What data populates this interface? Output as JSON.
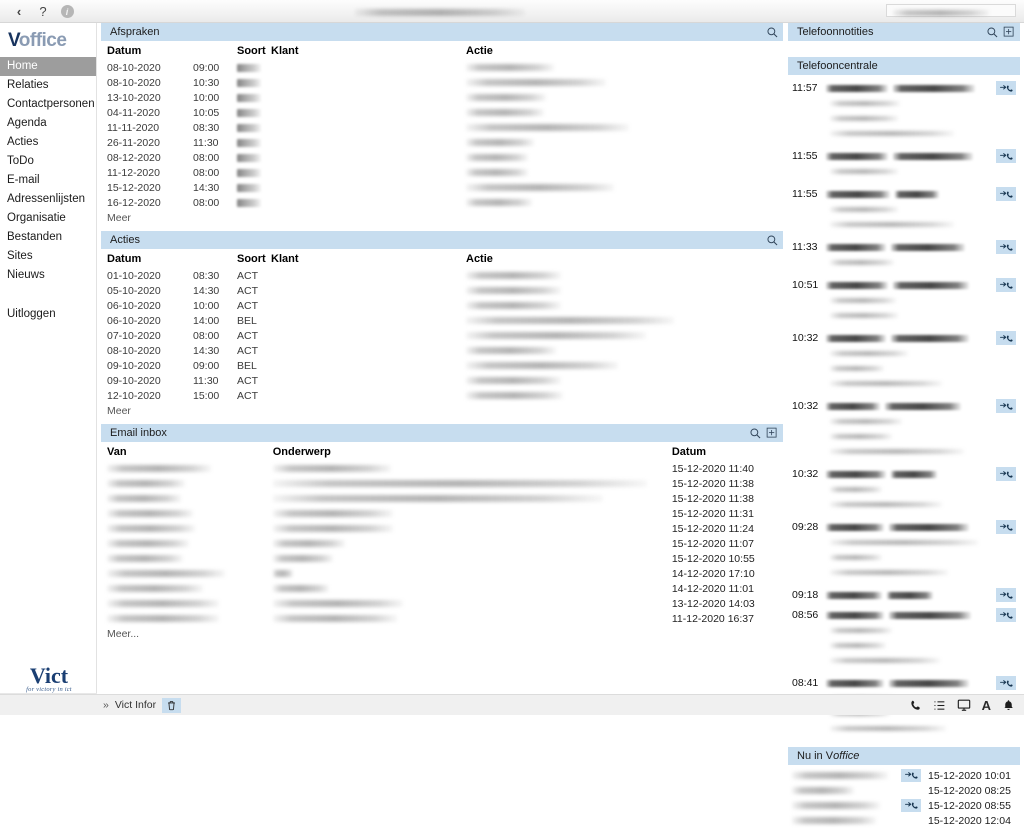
{
  "window": {
    "back_label": "‹",
    "help_label": "?",
    "info_label": "i",
    "title_redacted": true
  },
  "sidebar": {
    "logo_v": "V",
    "logo_office": "office",
    "items": [
      {
        "label": "Home",
        "active": true
      },
      {
        "label": "Relaties",
        "active": false
      },
      {
        "label": "Contactpersonen",
        "active": false
      },
      {
        "label": "Agenda",
        "active": false
      },
      {
        "label": "Acties",
        "active": false
      },
      {
        "label": "ToDo",
        "active": false
      },
      {
        "label": "E-mail",
        "active": false
      },
      {
        "label": "Adressenlijsten",
        "active": false
      },
      {
        "label": "Organisatie",
        "active": false
      },
      {
        "label": "Bestanden",
        "active": false
      },
      {
        "label": "Sites",
        "active": false
      },
      {
        "label": "Nieuws",
        "active": false
      }
    ],
    "logout_label": "Uitloggen",
    "footer_logo": "Vict",
    "footer_tagline": "for victory in ict"
  },
  "afspraken": {
    "title": "Afspraken",
    "columns": {
      "datum": "Datum",
      "soort": "Soort",
      "klant": "Klant",
      "actie": "Actie"
    },
    "rows": [
      {
        "datum": "08-10-2020",
        "tijd": "09:00",
        "soort_w": 24,
        "klant_w": 0,
        "actie_w": 88
      },
      {
        "datum": "08-10-2020",
        "tijd": "10:30",
        "soort_w": 24,
        "klant_w": 0,
        "actie_w": 140
      },
      {
        "datum": "13-10-2020",
        "tijd": "10:00",
        "soort_w": 24,
        "klant_w": 0,
        "actie_w": 80
      },
      {
        "datum": "04-11-2020",
        "tijd": "10:05",
        "soort_w": 24,
        "klant_w": 0,
        "actie_w": 78
      },
      {
        "datum": "11-11-2020",
        "tijd": "08:30",
        "soort_w": 24,
        "klant_w": 0,
        "actie_w": 163
      },
      {
        "datum": "26-11-2020",
        "tijd": "11:30",
        "soort_w": 24,
        "klant_w": 0,
        "actie_w": 68
      },
      {
        "datum": "08-12-2020",
        "tijd": "08:00",
        "soort_w": 24,
        "klant_w": 0,
        "actie_w": 62
      },
      {
        "datum": "11-12-2020",
        "tijd": "08:00",
        "soort_w": 24,
        "klant_w": 0,
        "actie_w": 62
      },
      {
        "datum": "15-12-2020",
        "tijd": "14:30",
        "soort_w": 24,
        "klant_w": 0,
        "actie_w": 148
      },
      {
        "datum": "16-12-2020",
        "tijd": "08:00",
        "soort_w": 24,
        "klant_w": 0,
        "actie_w": 66
      }
    ],
    "more_label": "Meer"
  },
  "acties": {
    "title": "Acties",
    "columns": {
      "datum": "Datum",
      "soort": "Soort",
      "klant": "Klant",
      "actie": "Actie"
    },
    "rows": [
      {
        "datum": "01-10-2020",
        "tijd": "08:30",
        "soort": "ACT",
        "actie_w": 95
      },
      {
        "datum": "05-10-2020",
        "tijd": "14:30",
        "soort": "ACT",
        "actie_w": 95
      },
      {
        "datum": "06-10-2020",
        "tijd": "10:00",
        "soort": "ACT",
        "actie_w": 95
      },
      {
        "datum": "06-10-2020",
        "tijd": "14:00",
        "soort": "BEL",
        "actie_w": 208
      },
      {
        "datum": "07-10-2020",
        "tijd": "08:00",
        "soort": "ACT",
        "actie_w": 180
      },
      {
        "datum": "08-10-2020",
        "tijd": "14:30",
        "soort": "ACT",
        "actie_w": 90
      },
      {
        "datum": "09-10-2020",
        "tijd": "09:00",
        "soort": "BEL",
        "actie_w": 152
      },
      {
        "datum": "09-10-2020",
        "tijd": "11:30",
        "soort": "ACT",
        "actie_w": 95
      },
      {
        "datum": "12-10-2020",
        "tijd": "15:00",
        "soort": "ACT",
        "actie_w": 97
      }
    ],
    "more_label": "Meer"
  },
  "email_inbox": {
    "title": "Email inbox",
    "columns": {
      "van": "Van",
      "onderwerp": "Onderwerp",
      "datum": "Datum"
    },
    "rows": [
      {
        "van_w": 104,
        "onderwerp_w": 118,
        "datum": "15-12-2020 11:40"
      },
      {
        "van_w": 78,
        "onderwerp_w": 374,
        "datum": "15-12-2020 11:38"
      },
      {
        "van_w": 74,
        "onderwerp_w": 330,
        "datum": "15-12-2020 11:38"
      },
      {
        "van_w": 86,
        "onderwerp_w": 120,
        "datum": "15-12-2020 11:31"
      },
      {
        "van_w": 88,
        "onderwerp_w": 120,
        "datum": "15-12-2020 11:24"
      },
      {
        "van_w": 82,
        "onderwerp_w": 72,
        "datum": "15-12-2020 11:07"
      },
      {
        "van_w": 76,
        "onderwerp_w": 60,
        "datum": "15-12-2020 10:55"
      },
      {
        "van_w": 118,
        "onderwerp_w": 20,
        "datum": "14-12-2020 17:10"
      },
      {
        "van_w": 96,
        "onderwerp_w": 56,
        "datum": "14-12-2020 11:01"
      },
      {
        "van_w": 112,
        "onderwerp_w": 130,
        "datum": "13-12-2020 14:03"
      },
      {
        "van_w": 112,
        "onderwerp_w": 124,
        "datum": "11-12-2020 16:37"
      }
    ],
    "more_label": "Meer..."
  },
  "telefoonnotities": {
    "title": "Telefoonnotities"
  },
  "telefooncentrale": {
    "title": "Telefooncentrale",
    "entries": [
      {
        "tijd": "11:57",
        "num_w": 62,
        "name_w": 82,
        "sub": [
          70,
          68,
          124
        ]
      },
      {
        "tijd": "11:55",
        "num_w": 62,
        "name_w": 80,
        "sub": [
          68
        ]
      },
      {
        "tijd": "11:55",
        "num_w": 64,
        "name_w": 44,
        "sub": [
          68,
          124
        ]
      },
      {
        "tijd": "11:33",
        "num_w": 60,
        "name_w": 74,
        "sub": [
          64
        ]
      },
      {
        "tijd": "10:51",
        "num_w": 62,
        "name_w": 76,
        "sub": [
          66,
          68
        ]
      },
      {
        "tijd": "10:32",
        "num_w": 60,
        "name_w": 78,
        "sub": [
          78,
          54,
          112
        ]
      },
      {
        "tijd": "10:32",
        "num_w": 54,
        "name_w": 76,
        "sub": [
          72,
          62,
          134
        ]
      },
      {
        "tijd": "10:32",
        "num_w": 60,
        "name_w": 46,
        "sub": [
          52,
          112
        ]
      },
      {
        "tijd": "09:28",
        "num_w": 58,
        "name_w": 80,
        "sub": [
          148,
          52,
          118
        ]
      },
      {
        "tijd": "09:18",
        "num_w": 56,
        "name_w": 46,
        "sub": []
      },
      {
        "tijd": "08:56",
        "num_w": 58,
        "name_w": 82,
        "sub": [
          62,
          56,
          110
        ]
      },
      {
        "tijd": "08:41",
        "num_w": 58,
        "name_w": 80,
        "sub": [
          66,
          60,
          116
        ]
      }
    ]
  },
  "nu_in_voffice": {
    "title_prefix": "Nu in ",
    "title_v": "V",
    "title_office": "office",
    "rows": [
      {
        "name_w": 96,
        "has_call": true,
        "datum": "15-12-2020 10:01"
      },
      {
        "name_w": 62,
        "has_call": false,
        "datum": "15-12-2020 08:25"
      },
      {
        "name_w": 88,
        "has_call": true,
        "datum": "15-12-2020 08:55"
      },
      {
        "name_w": 84,
        "has_call": false,
        "datum": "15-12-2020 12:04"
      }
    ]
  },
  "bottombar": {
    "chevron": "»",
    "label": "Vict Infor",
    "status_icons": [
      "phone-icon",
      "list-icon",
      "monitor-icon",
      "text-size-icon",
      "bell-icon"
    ]
  },
  "colors": {
    "panel_header": "#c7ddef",
    "sidebar_active": "#9d9d9d",
    "logo_dark": "#17335e",
    "logo_light": "#8a9bb3",
    "vict_blue": "#1b3f73"
  }
}
